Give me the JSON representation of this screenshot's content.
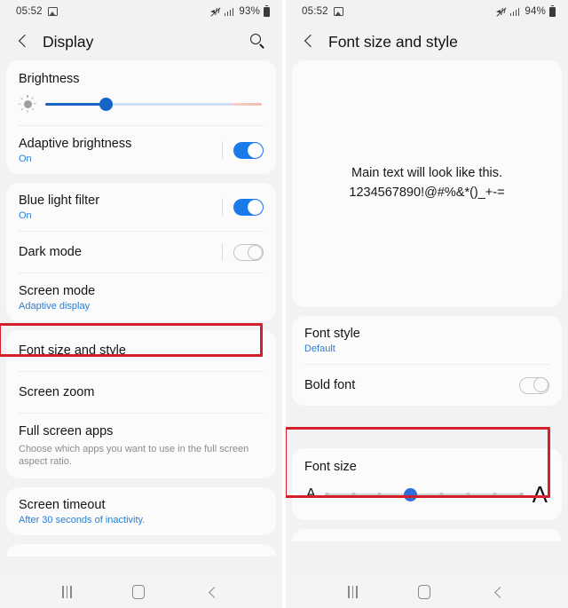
{
  "left_screen": {
    "status_bar": {
      "time": "05:52",
      "gallery_icon": "gallery-icon",
      "mute_icon": "mute-icon",
      "signal_icon": "signal-bars-icon",
      "battery_percent": "93%",
      "battery_icon": "battery-icon"
    },
    "app_bar": {
      "back_label": "back-chevron",
      "title": "Display",
      "search_label": "search-icon"
    },
    "brightness": {
      "title": "Brightness",
      "sun_icon": "brightness-sun-icon",
      "value_percent": 28,
      "fill_color": "#1565c8",
      "track_color": "#cfe0f5",
      "warm_color": "#f2bdb2"
    },
    "adaptive_brightness": {
      "title": "Adaptive brightness",
      "subtitle": "On",
      "toggle_state": "on"
    },
    "blue_light_filter": {
      "title": "Blue light filter",
      "subtitle": "On",
      "toggle_state": "on"
    },
    "dark_mode": {
      "title": "Dark mode",
      "toggle_state": "off"
    },
    "screen_mode": {
      "title": "Screen mode",
      "subtitle": "Adaptive display"
    },
    "font_size_and_style": {
      "title": "Font size and style",
      "highlighted": true
    },
    "screen_zoom": {
      "title": "Screen zoom"
    },
    "full_screen_apps": {
      "title": "Full screen apps",
      "subtitle": "Choose which apps you want to use in the full screen aspect ratio."
    },
    "screen_timeout": {
      "title": "Screen timeout",
      "subtitle": "After 30 seconds of inactivity."
    },
    "nav_bar": {
      "recents": "recents-icon",
      "home": "home-icon",
      "back": "back-icon"
    }
  },
  "right_screen": {
    "status_bar": {
      "time": "05:52",
      "gallery_icon": "gallery-icon",
      "mute_icon": "mute-icon",
      "signal_icon": "signal-bars-icon",
      "battery_percent": "94%",
      "battery_icon": "battery-icon"
    },
    "app_bar": {
      "back_label": "back-chevron",
      "title": "Font size and style"
    },
    "preview": {
      "line1": "Main text will look like this.",
      "line2": "1234567890!@#%&*()_+-="
    },
    "font_style": {
      "title": "Font style",
      "subtitle": "Default"
    },
    "bold_font": {
      "title": "Bold font",
      "toggle_state": "off"
    },
    "font_size": {
      "title": "Font size",
      "small_a": "A",
      "large_a": "A",
      "steps": 8,
      "selected_index": 3,
      "active_color": "#2f6fdb",
      "tick_color": "#bdbdbd",
      "highlighted": true
    },
    "nav_bar": {
      "recents": "recents-icon",
      "home": "home-icon",
      "back": "back-icon"
    }
  },
  "annotations": {
    "accent_color": "#d3202a",
    "boxes": [
      {
        "target": "font-size-and-style-row",
        "screen": "left"
      },
      {
        "target": "font-size-slider-card",
        "screen": "right"
      }
    ]
  }
}
